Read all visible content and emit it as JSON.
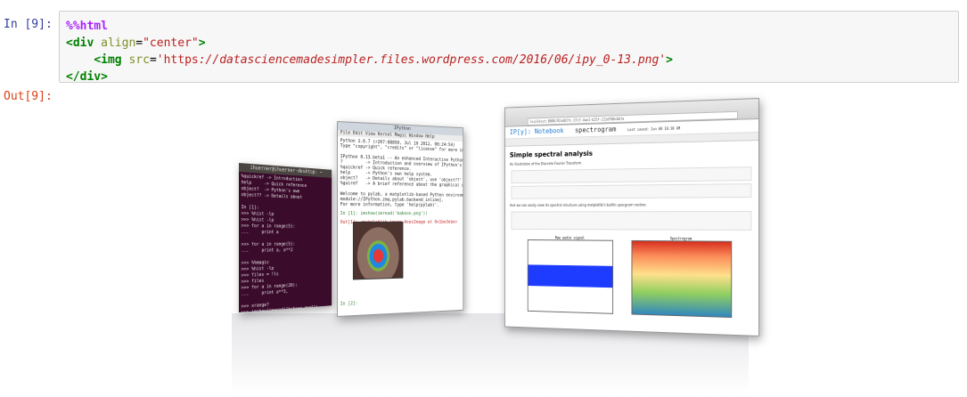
{
  "input_cell": {
    "prompt": "In [9]:",
    "line1": "%%html",
    "line2_open": "<",
    "line2_tag": "div",
    "line2_attr": " align",
    "line2_eq": "=",
    "line2_val": "\"center\"",
    "line2_close": ">",
    "line3_open": "<",
    "line3_tag": "img",
    "line3_attr": " src",
    "line3_eq": "=",
    "line3_val_a": "'https",
    "line3_val_b": "://datasciencemadesimpler.files.wordpress.com/2016/06/ipy_0-13.png'",
    "line3_close": ">",
    "line4": "</div>"
  },
  "output_cell": {
    "prompt": "Out[9]:"
  },
  "image": {
    "terminal_title": "ihuerner@ihuerner-desktop: ~",
    "terminal_lines": "%quickref -> Introduction\nhelp     -> Quick reference\nobject?  -> Python's own\nobject?? -> Details about\n\nIn [1]:\n>>> %hist -lp\n>>> %hist -lp\n>>> for a in range(5):\n...     print a\n\n>>> for a in range(5):\n...     print a, a**2\n\n>>> %%magic\n>>> %hist -lp\n>>> files = !ls\n>>> files\n>>> for a in range(20):\n...     print a**3,\n\n>>> xrange?\n>>> imshow(imread(\"baboon.png\"))",
    "qt_title": "IPython",
    "qt_menu": "File  Edit  View  Kernel  Magic  Window  Help",
    "qt_lines": "Python 2.6.7 (r267:88850, Jul 10 2012, 08:24:54)\nType \"copyright\", \"credits\" or \"license\" for more information.\n\nIPython 0.13.beta1 -- An enhanced Interactive Python.\n?         -> Introduction and overview of IPython's features.\n%quickref -> Quick reference.\nhelp      -> Python's own help system.\nobject?   -> Details about 'object', use 'object??' for extra.\n%guiref   -> A brief reference about the graphical user interface.\n\nWelcome to pylab, a matplotlib-based Python environment [backend:\nmodule://IPython.zmq.pylab.backend_inline].\nFor more information, type 'help(pylab)'.",
    "qt_in1": "In [1]: imshow(imread('baboon.png'))",
    "qt_out1": "Out[1]: <matplotlib.image.AxesImage at 0x1be3ebe>",
    "qt_in2": "In [2]:",
    "nb_url": "localhost:8888/92a4b5fc-37c7-4ae1-b25f-211d708c6bfa",
    "nb_brand": "IP[y]: Notebook",
    "nb_name": "spectrogram",
    "nb_saved": "Last saved: Jun 08 10:38 AM",
    "nb_h1": "Simple spectral analysis",
    "nb_p1": "An illustration of the Discrete Fourier Transform",
    "nb_p2": "And we can easily view its spectral structure using matplotlib's builtin specgram routine:",
    "nb_plot1_title": "Raw audio signal",
    "nb_plot2_title": "Spectrogram"
  }
}
